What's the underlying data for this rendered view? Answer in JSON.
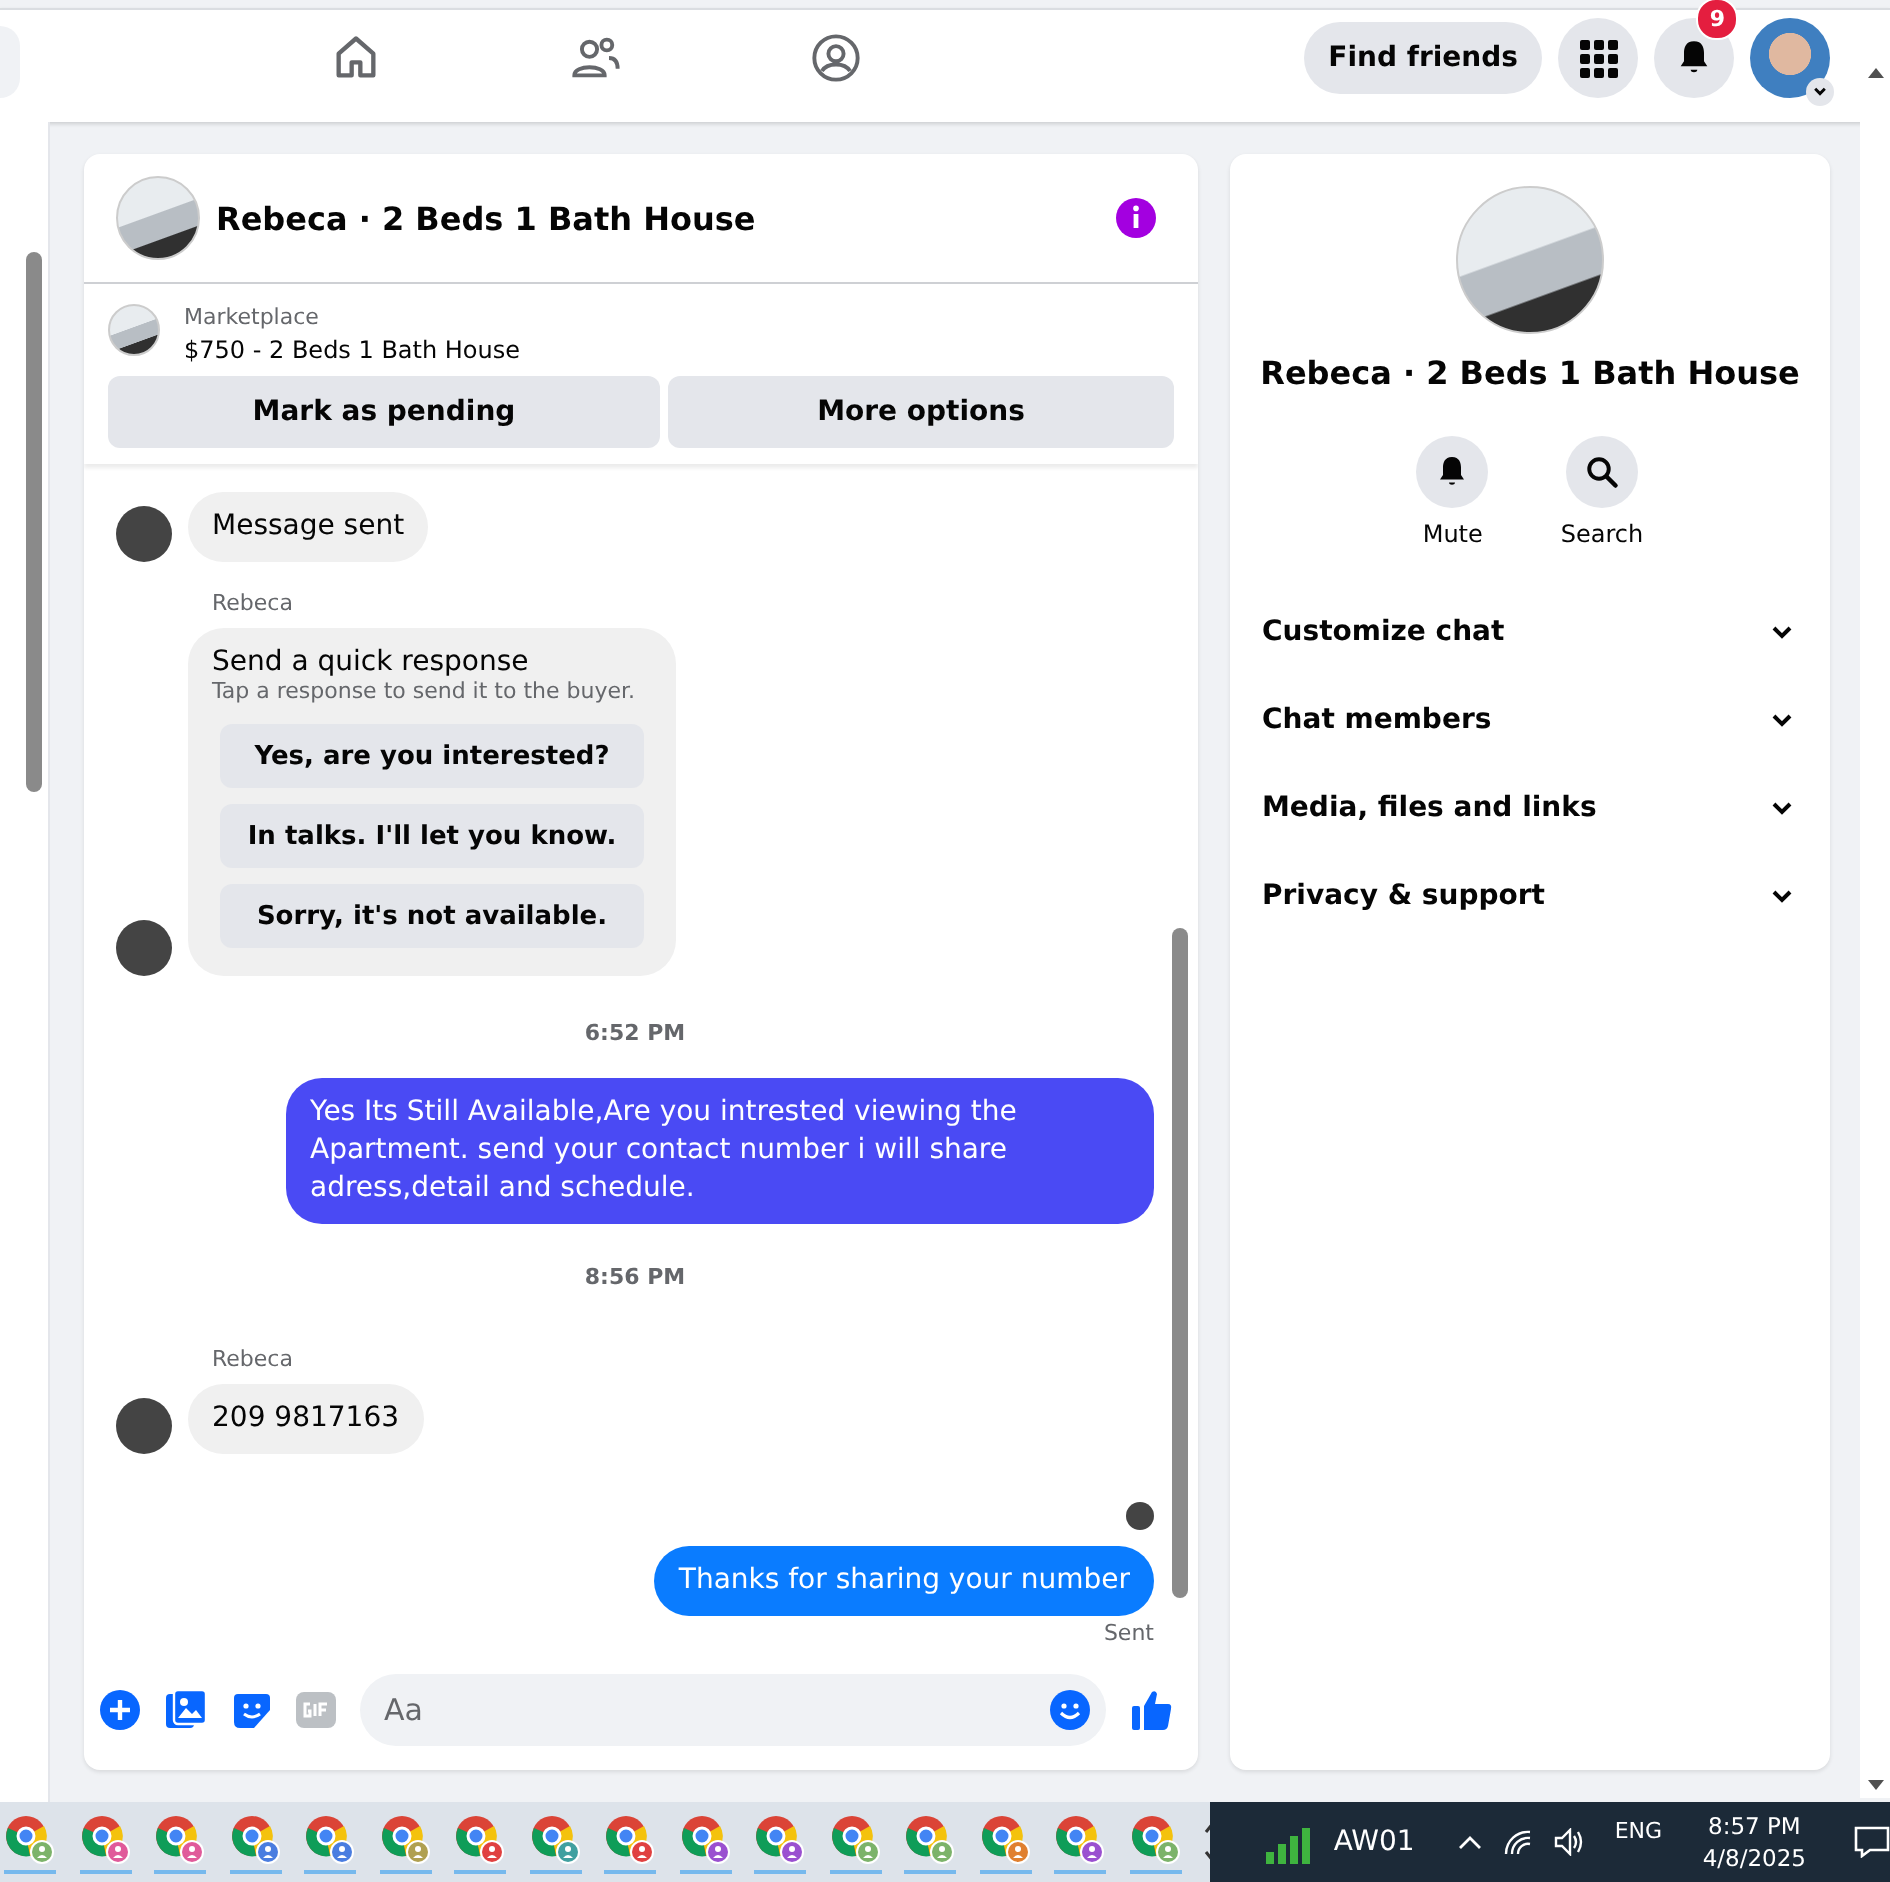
{
  "top_nav": {
    "find_friends": "Find friends",
    "notification_count": "9"
  },
  "chat": {
    "title": "Rebeca · 2 Beds 1 Bath House",
    "listing": {
      "source": "Marketplace",
      "summary": "$750 - 2 Beds 1 Bath House"
    },
    "actions": [
      "Mark as pending",
      "More options"
    ],
    "messages": [
      {
        "kind": "incoming",
        "text": "Message sent"
      },
      {
        "kind": "sender",
        "text": "Rebeca"
      },
      {
        "kind": "quick",
        "title": "Send a quick response",
        "hint": "Tap a response to send it to the buyer.",
        "options": [
          "Yes, are you interested?",
          "In talks. I'll let you know.",
          "Sorry, it's not available."
        ]
      },
      {
        "kind": "time",
        "text": "6:52 PM"
      },
      {
        "kind": "outgoing",
        "text": "Yes Its Still Available,Are you intrested viewing the Apartment. send your contact number i will share adress,detail and schedule.",
        "color": "#4a4af4"
      },
      {
        "kind": "time",
        "text": "8:56 PM"
      },
      {
        "kind": "sender",
        "text": "Rebeca"
      },
      {
        "kind": "incoming",
        "text": "209 9817163"
      },
      {
        "kind": "seen"
      },
      {
        "kind": "outgoing",
        "text": "Thanks for sharing your number",
        "color": "#0a7cff"
      },
      {
        "kind": "status",
        "text": "Sent"
      }
    ],
    "composer": {
      "placeholder": "Aa"
    }
  },
  "info_panel": {
    "title": "Rebeca · 2 Beds 1 Bath House",
    "actions": [
      {
        "label": "Mute"
      },
      {
        "label": "Search"
      }
    ],
    "sections": [
      {
        "label": "Customize chat",
        "expanded": false
      },
      {
        "label": "Chat members",
        "expanded": false
      },
      {
        "label": "Media, files and links",
        "expanded": false
      },
      {
        "label": "Privacy & support",
        "expanded": false
      }
    ]
  },
  "taskbar": {
    "apps": [
      {
        "color": "#7cb36a"
      },
      {
        "color": "#e05a9a"
      },
      {
        "color": "#e05a9a"
      },
      {
        "color": "#4a7de0"
      },
      {
        "color": "#4a7de0"
      },
      {
        "color": "#b0a050"
      },
      {
        "color": "#e04040"
      },
      {
        "color": "#40a0a0"
      },
      {
        "color": "#e04040"
      },
      {
        "color": "#9a50d0"
      },
      {
        "color": "#9a50d0"
      },
      {
        "color": "#7cb36a"
      },
      {
        "color": "#7cb36a"
      },
      {
        "color": "#e08030"
      },
      {
        "color": "#9a50d0"
      },
      {
        "color": "#7cb36a"
      }
    ],
    "network_label": "AW01",
    "language": "ENG",
    "time": "8:57 PM",
    "date": "4/8/2025"
  }
}
